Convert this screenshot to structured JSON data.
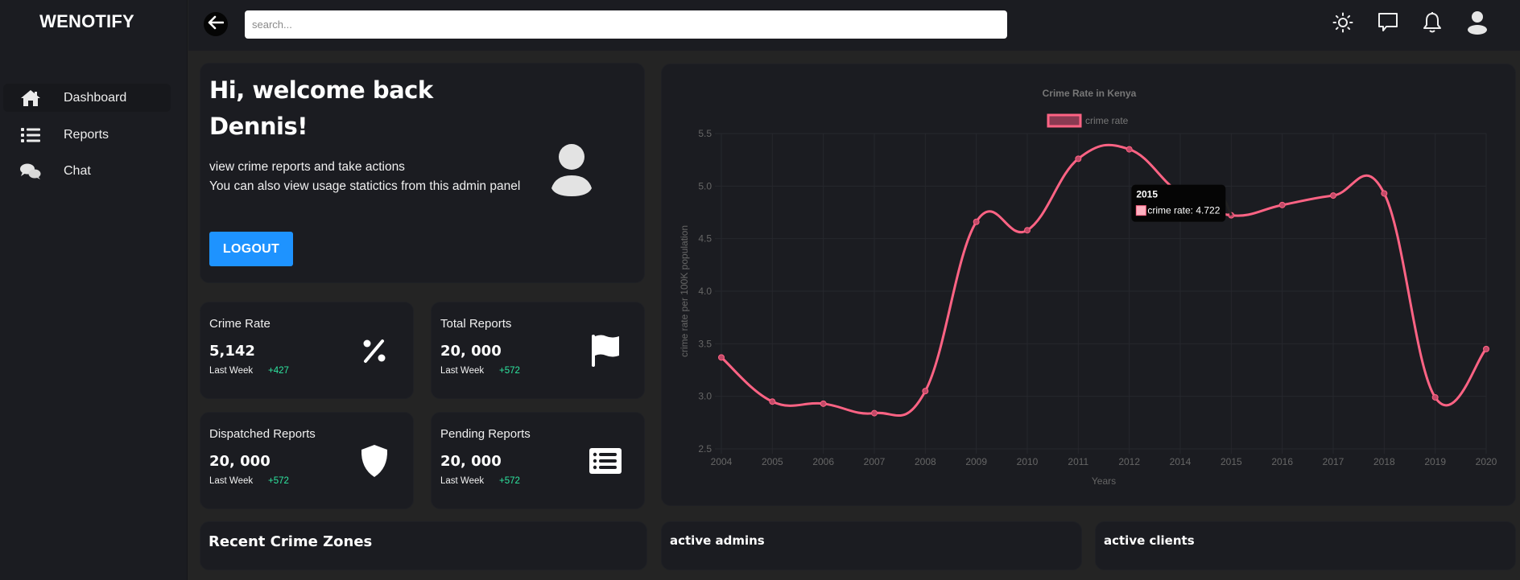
{
  "sidebar": {
    "brand": "WENOTIFY",
    "items": [
      {
        "label": "Dashboard",
        "icon": "home-icon",
        "active": true
      },
      {
        "label": "Reports",
        "icon": "list-icon",
        "active": false
      },
      {
        "label": "Chat",
        "icon": "chat-bubbles-icon",
        "active": false
      }
    ]
  },
  "header": {
    "search_placeholder": "search...",
    "search_value": "",
    "icons": [
      "sun-icon",
      "message-icon",
      "bell-icon",
      "user-icon"
    ]
  },
  "welcome": {
    "line1": "Hi, welcome back",
    "line2": "Dennis!",
    "desc1": "view crime reports and take actions",
    "desc2": "You can also view usage statictics from this admin panel",
    "logout_label": "LOGOUT"
  },
  "stats": [
    {
      "title": "Crime Rate",
      "value": "5,142",
      "period": "Last Week",
      "change": "+427",
      "icon": "percent-icon"
    },
    {
      "title": "Total Reports",
      "value": "20, 000",
      "period": "Last Week",
      "change": "+572",
      "icon": "flag-icon"
    },
    {
      "title": "Dispatched Reports",
      "value": "20, 000",
      "period": "Last Week",
      "change": "+572",
      "icon": "shield-icon"
    },
    {
      "title": "Pending Reports",
      "value": "20, 000",
      "period": "Last Week",
      "change": "+572",
      "icon": "list-box-icon"
    }
  ],
  "bottom_cards": {
    "recent": "Recent Crime Zones",
    "admins": "active admins",
    "clients": "active clients"
  },
  "colors": {
    "accent": "#1e93ff",
    "line": "#ff6384",
    "positive": "#2ee6a0"
  },
  "chart_data": {
    "type": "line",
    "title": "Crime Rate in Kenya",
    "xlabel": "Years",
    "ylabel": "crime rate per 100K population",
    "legend": [
      "crime rate"
    ],
    "legend_position": "top",
    "grid": true,
    "categories": [
      "2004",
      "2005",
      "2006",
      "2007",
      "2008",
      "2009",
      "2010",
      "2011",
      "2012",
      "2014",
      "2015",
      "2016",
      "2017",
      "2018",
      "2019",
      "2020"
    ],
    "series": [
      {
        "name": "crime rate",
        "values": [
          3.37,
          2.95,
          2.93,
          2.84,
          3.05,
          4.66,
          4.58,
          5.26,
          5.35,
          4.93,
          4.722,
          4.82,
          4.91,
          4.93,
          2.99,
          3.45
        ]
      }
    ],
    "ylim": [
      2.5,
      5.5
    ],
    "yticks": [
      "2.5",
      "3.0",
      "3.5",
      "4.0",
      "4.5",
      "5.0",
      "5.5"
    ],
    "tooltip": {
      "title": "2015",
      "label": "crime rate: 4.722",
      "index": 10
    }
  }
}
